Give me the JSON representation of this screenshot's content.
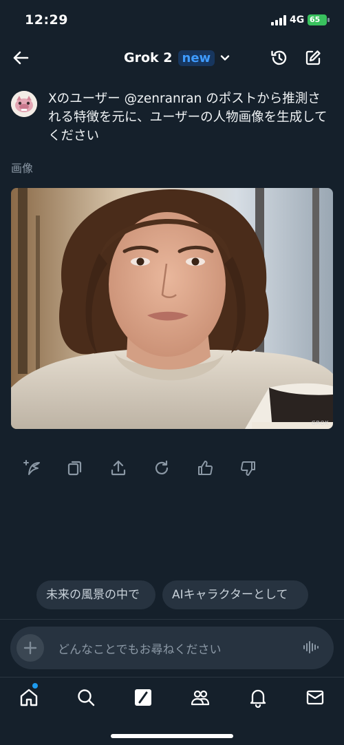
{
  "status_bar": {
    "time": "12:29",
    "network": "4G",
    "battery": "65"
  },
  "header": {
    "title": "Grok 2",
    "badge": "new"
  },
  "prompt": {
    "text": "Xのユーザー @zenranran のポストから推測される特徴を元に、ユーザーの人物画像を生成してください"
  },
  "result": {
    "label": "画像",
    "watermark": "GROK"
  },
  "actions": [
    "sparkle-pen-icon",
    "copy-icon",
    "share-icon",
    "regenerate-icon",
    "thumbs-up-icon",
    "thumbs-down-icon"
  ],
  "suggestions": [
    "未来の風景の中で",
    "AIキャラクターとして"
  ],
  "input": {
    "placeholder": "どんなことでもお尋ねください"
  },
  "tabs": [
    "home-icon",
    "search-icon",
    "grok-icon",
    "communities-icon",
    "notifications-icon",
    "messages-icon"
  ],
  "colors": {
    "background": "#15202b",
    "accent": "#1d9bf0",
    "badge_text": "#3e9bff",
    "battery": "#39c15e"
  }
}
